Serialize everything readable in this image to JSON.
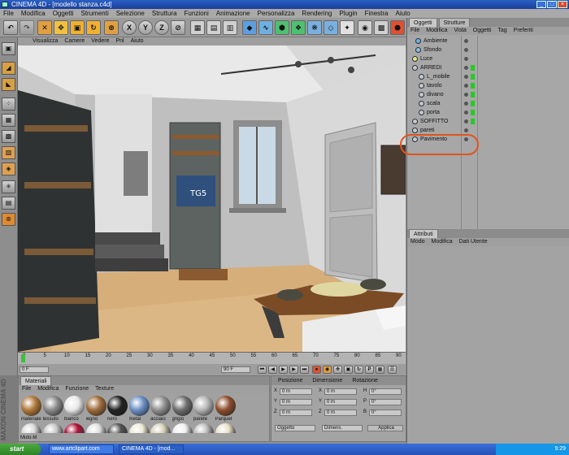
{
  "window": {
    "title": "CINEMA 4D - [modello stanza.c4d]"
  },
  "menubar": [
    "File",
    "Modifica",
    "Oggetti",
    "Strumenti",
    "Selezione",
    "Struttura",
    "Funzioni",
    "Animazione",
    "Personalizza",
    "Rendering",
    "Plugin",
    "Finestra",
    "Aiuto"
  ],
  "viewport": {
    "menu": [
      "Visualizza",
      "Camere",
      "Vedere",
      "Pnl",
      "Aiuto"
    ],
    "tv_logo": "TG5"
  },
  "timeline": {
    "ticks": [
      "0",
      "5",
      "10",
      "15",
      "20",
      "25",
      "30",
      "35",
      "40",
      "45",
      "50",
      "55",
      "60",
      "65",
      "70",
      "75",
      "80",
      "85",
      "90"
    ],
    "frame_left": "0 F",
    "frame_right": "90 F"
  },
  "materials": {
    "tabs": [
      "Materiali"
    ],
    "menu": [
      "File",
      "Modifica",
      "Funzione",
      "Texture"
    ],
    "items": [
      {
        "label": "materiale",
        "color": "#b0793b"
      },
      {
        "label": "tessuto",
        "color": "#8a8a8a"
      },
      {
        "label": "bianco",
        "color": "#e8e8e8"
      },
      {
        "label": "legno",
        "color": "#9c6b3a"
      },
      {
        "label": "nero",
        "color": "#222222"
      },
      {
        "label": "metal",
        "color": "#6a8fc4"
      },
      {
        "label": "acciaio",
        "color": "#8f8f8f"
      },
      {
        "label": "grigio",
        "color": "#6f6f6f"
      },
      {
        "label": "parete",
        "color": "#b5b5b5"
      },
      {
        "label": "Parquet",
        "color": "#8c4e2e"
      }
    ],
    "row2_colors": [
      "#d9d9d9",
      "#c7c7c7",
      "#b3133a",
      "#e0e0e0",
      "#555555",
      "#efe9d6",
      "#d8d1b9",
      "#efefef",
      "#bfbfbf",
      "#e9e0c7"
    ],
    "footer": "Muto-M"
  },
  "coords": {
    "header": [
      "Posizione",
      "Dimensione",
      "Rotazione"
    ],
    "rows": [
      [
        "X",
        "0 m",
        "X",
        "0 m",
        "H",
        "0°"
      ],
      [
        "Y",
        "0 m",
        "Y",
        "0 m",
        "P",
        "0°"
      ],
      [
        "Z",
        "0 m",
        "Z",
        "0 m",
        "B",
        "0°"
      ]
    ],
    "mode_left": "Oggetto",
    "mode_right": "Dimens.",
    "apply": "Applica"
  },
  "object_manager": {
    "tabs": [
      "Oggetti",
      "Strutture"
    ],
    "menu": [
      "File",
      "Modifica",
      "Vista",
      "Oggetti",
      "Tag",
      "Preferiti"
    ],
    "rows": [
      {
        "name": "Ambiente",
        "indent": 8,
        "icon_color": "#6fb3d8"
      },
      {
        "name": "Sfondo",
        "indent": 8,
        "icon_color": "#8fbfe0"
      },
      {
        "name": "Luce",
        "indent": 4,
        "icon_color": "#f2e27a"
      },
      {
        "name": "ARREDI",
        "indent": 4,
        "icon_color": "#c8c8c8"
      },
      {
        "name": "L_mobile",
        "indent": 12,
        "icon_color": "#c8c8c8"
      },
      {
        "name": "tavolo",
        "indent": 12,
        "icon_color": "#c8c8c8"
      },
      {
        "name": "divano",
        "indent": 12,
        "icon_color": "#c8c8c8"
      },
      {
        "name": "scala",
        "indent": 12,
        "icon_color": "#c8c8c8"
      },
      {
        "name": "porta",
        "indent": 12,
        "icon_color": "#c8c8c8"
      },
      {
        "name": "SOFFITTO",
        "indent": 4,
        "icon_color": "#c8c8c8"
      },
      {
        "name": "pareti",
        "indent": 4,
        "icon_color": "#c8c8c8"
      },
      {
        "name": "Pavimento",
        "indent": 4,
        "icon_color": "#c8c8c8"
      }
    ]
  },
  "attribute_manager": {
    "title": "Attributi",
    "menu": [
      "Modo",
      "Modifica",
      "Dati Utente"
    ]
  },
  "left_brand": "MAXON CINEMA 4D",
  "taskbar": {
    "start": "start",
    "tasks": [
      "www.artclipart.com",
      "CINEMA 4D - [mod...",
      ""
    ],
    "clock": "9:29"
  }
}
